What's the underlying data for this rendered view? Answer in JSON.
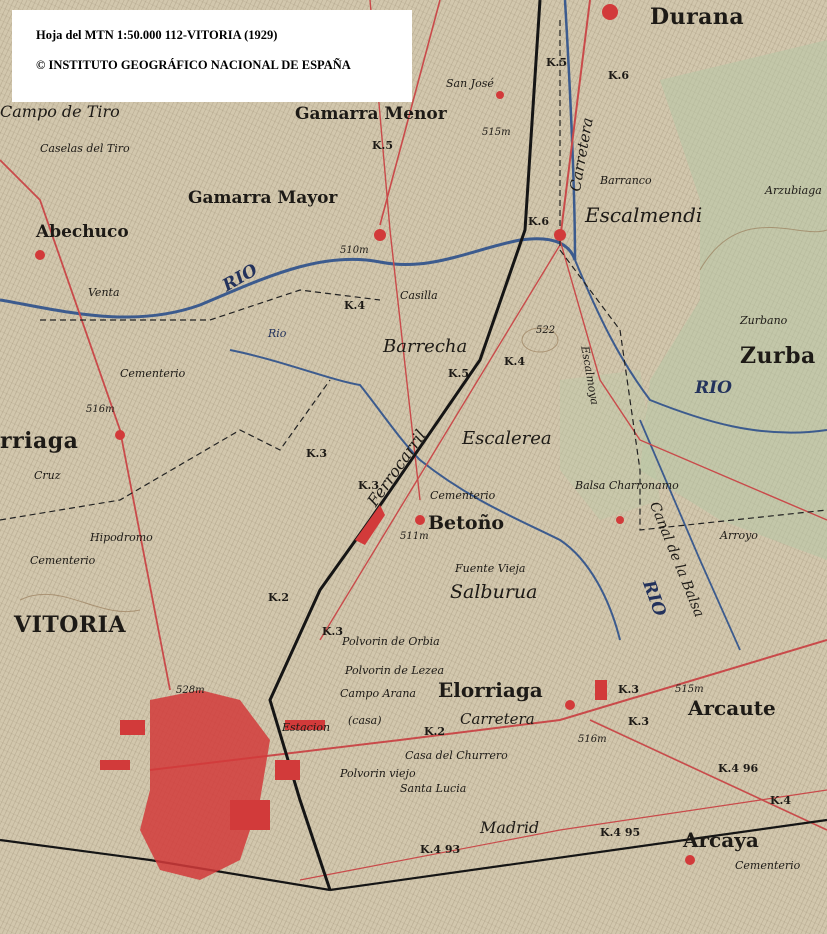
{
  "attribution": {
    "sheet": "Hoja del MTN 1:50.000  112-VITORIA (1929)",
    "copyright": "© INSTITUTO GEOGRÁFICO NACIONAL DE ESPAÑA"
  },
  "places": {
    "durana": "Durana",
    "gamarra_menor": "Gamarra Menor",
    "gamarra_mayor": "Gamarra Mayor",
    "abechuco": "Abechuco",
    "escalmendi": "Escalmendi",
    "zurba": "Zurba",
    "arriaga": "rriaga",
    "betono": "Betoño",
    "vitoria": "VITORIA",
    "elorriaga": "Elorriaga",
    "arcaute": "Arcaute",
    "arcaya": "Arcaya",
    "salburua": "Salburua",
    "barrecha": "Barrecha",
    "escalerea": "Escalerea"
  },
  "labels": {
    "campo_tiro": "Campo de Tiro",
    "casetas": "Caselas del Tiro",
    "san_jose": "San José",
    "venta": "Venta",
    "casilla": "Casilla",
    "cementerio_1": "Cementerio",
    "cementerio_2": "Cementerio",
    "cementerio_3": "Cementerio",
    "cementerio_4": "Cementerio",
    "cruz": "Cruz",
    "hipodromo": "Hipodromo",
    "fuente_vieja": "Fuente Vieja",
    "polvorin_orbia": "Polvorin de Orbia",
    "polvorin_lezea": "Polvorin de Lezea",
    "campo_arana": "Campo Arana",
    "casa": "(casa)",
    "estacion": "Estacion",
    "casa_churrero": "Casa del Churrero",
    "polvorin_viejo": "Polvorin viejo",
    "santa_lucia": "Santa Lucia",
    "balsa_charronamo": "Balsa Charronamo",
    "canal_balsa": "Canal de la Balsa",
    "arroyo": "Arroyo",
    "escalmoya": "Escalmoya",
    "zurbano": "Zurbano",
    "arzubiaga": "Arzubiaga",
    "barranco": "Barranco",
    "carretera_1": "Carretera",
    "carretera_2": "Carretera",
    "madrid": "Madrid",
    "ferrocarril": "Ferrocarril",
    "rio_1": "RIO",
    "rio_2": "RIO",
    "rio_3": "RIO",
    "rio_4": "Rio",
    "elev_515": "515m",
    "elev_510": "510m",
    "elev_522": "522",
    "elev_516": "516m",
    "elev_511": "511m",
    "elev_528": "528m",
    "elev_516b": "516m",
    "elev_515b": "515m"
  },
  "km_markers": [
    "K.5",
    "K.6",
    "K.6",
    "K.5",
    "K.4",
    "K.5",
    "K.4",
    "K.3",
    "K.3",
    "K.2",
    "K.3",
    "K.2",
    "K.3",
    "K.3",
    "K.4 96",
    "K.4 95",
    "K.4 93",
    "K.4"
  ]
}
